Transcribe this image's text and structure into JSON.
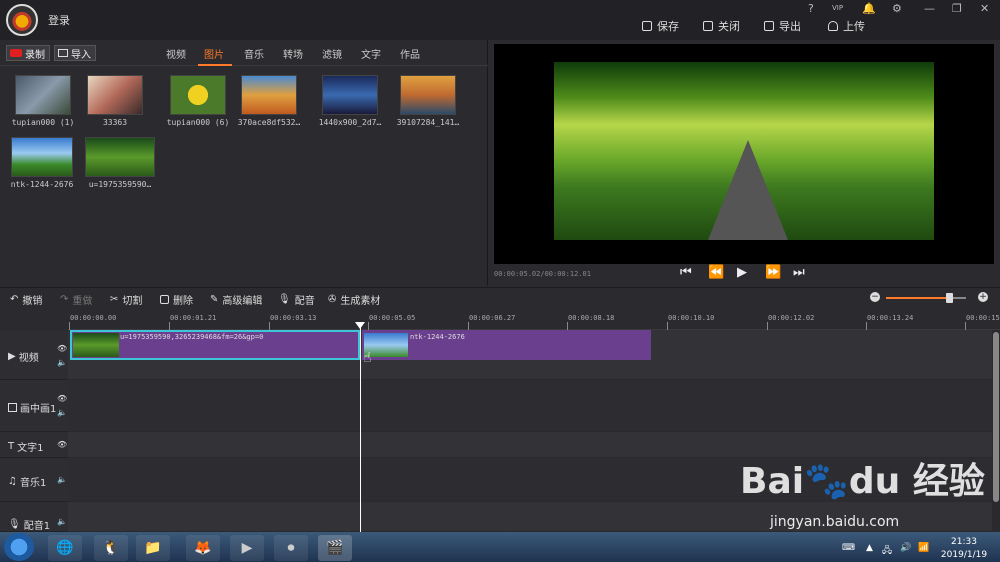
{
  "header": {
    "login": "登录",
    "window_buttons": [
      "?",
      "VIP",
      "🔔",
      "⚙",
      "—",
      "❐",
      "✕"
    ],
    "actions": [
      {
        "name": "save",
        "label": "保存"
      },
      {
        "name": "close",
        "label": "关闭"
      },
      {
        "name": "export",
        "label": "导出"
      },
      {
        "name": "upload",
        "label": "上传"
      }
    ]
  },
  "library": {
    "record_label": "录制",
    "import_label": "导入",
    "tabs": [
      "视频",
      "图片",
      "音乐",
      "转场",
      "滤镜",
      "文字",
      "作品"
    ],
    "active_tab": "图片",
    "items": [
      {
        "label": "tupian000 (1)",
        "color": "#6a7a8a"
      },
      {
        "label": "33363",
        "color": "#b46a5a"
      },
      {
        "label": "tupian000 (6)",
        "color": "#c8b02a"
      },
      {
        "label": "370ace8df532…",
        "color": "#d08a3a"
      },
      {
        "label": "1440x900_2d7…",
        "color": "#2a4a8a"
      },
      {
        "label": "39107284_141…",
        "color": "#c88a3a"
      },
      {
        "label": "ntk-1244-2676",
        "color": "#4a8ac8"
      },
      {
        "label": "u=1975359590…",
        "color": "#3a7a2a"
      }
    ]
  },
  "preview": {
    "timecode": "00:00:05.02/00:00:12.01",
    "controls": [
      "⏮",
      "⏪",
      "▶",
      "⏩",
      "⏭"
    ]
  },
  "toolbar": {
    "items": [
      {
        "label": "撤销",
        "dim": false
      },
      {
        "label": "重做",
        "dim": true
      },
      {
        "label": "切割",
        "dim": false
      },
      {
        "label": "删除",
        "dim": false
      },
      {
        "label": "高级编辑",
        "dim": false
      },
      {
        "label": "配音",
        "dim": false
      },
      {
        "label": "生成素材",
        "dim": false
      }
    ]
  },
  "timeline": {
    "ticks": [
      "00:00:00.00",
      "00:00:01.21",
      "00:00:03.13",
      "00:00:05.05",
      "00:00:06.27",
      "00:00:08.18",
      "00:00:10.10",
      "00:00:12.02",
      "00:00:13.24",
      "00:00:15"
    ],
    "tracks": [
      {
        "name": "视频"
      },
      {
        "name": "画中画1"
      },
      {
        "name": "文字1"
      },
      {
        "name": "音乐1"
      },
      {
        "name": "配音1"
      }
    ],
    "clips": [
      {
        "label": "u=1975359590,3265239468&fm=26&gp=0"
      },
      {
        "label": "ntk-1244-2676"
      }
    ]
  },
  "taskbar": {
    "time": "21:33",
    "date": "2019/1/19"
  },
  "watermark": {
    "main": "Bai🐾du 经验",
    "sub": "jingyan.baidu.com"
  }
}
